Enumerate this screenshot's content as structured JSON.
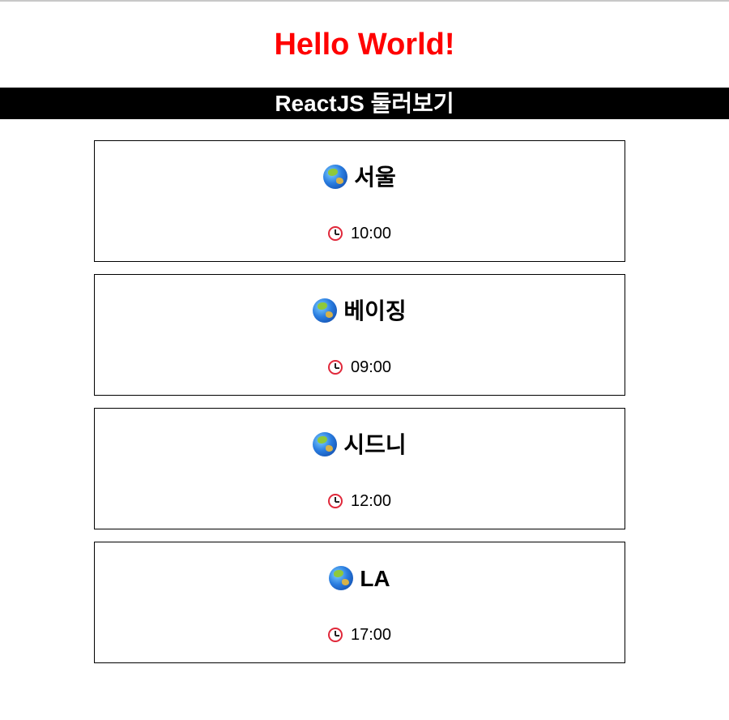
{
  "header": {
    "title": "Hello World!",
    "title_color": "#ff0000",
    "subtitle": "ReactJS 둘러보기",
    "subtitle_bg": "#000000",
    "subtitle_color": "#ffffff"
  },
  "cities": [
    {
      "name": "서울",
      "time": "10:00",
      "icon": "globe-icon"
    },
    {
      "name": "베이징",
      "time": "09:00",
      "icon": "globe-icon"
    },
    {
      "name": "시드니",
      "time": "12:00",
      "icon": "globe-icon"
    },
    {
      "name": "LA",
      "time": "17:00",
      "icon": "globe-icon"
    }
  ],
  "time_icon": "alarm-clock-icon"
}
